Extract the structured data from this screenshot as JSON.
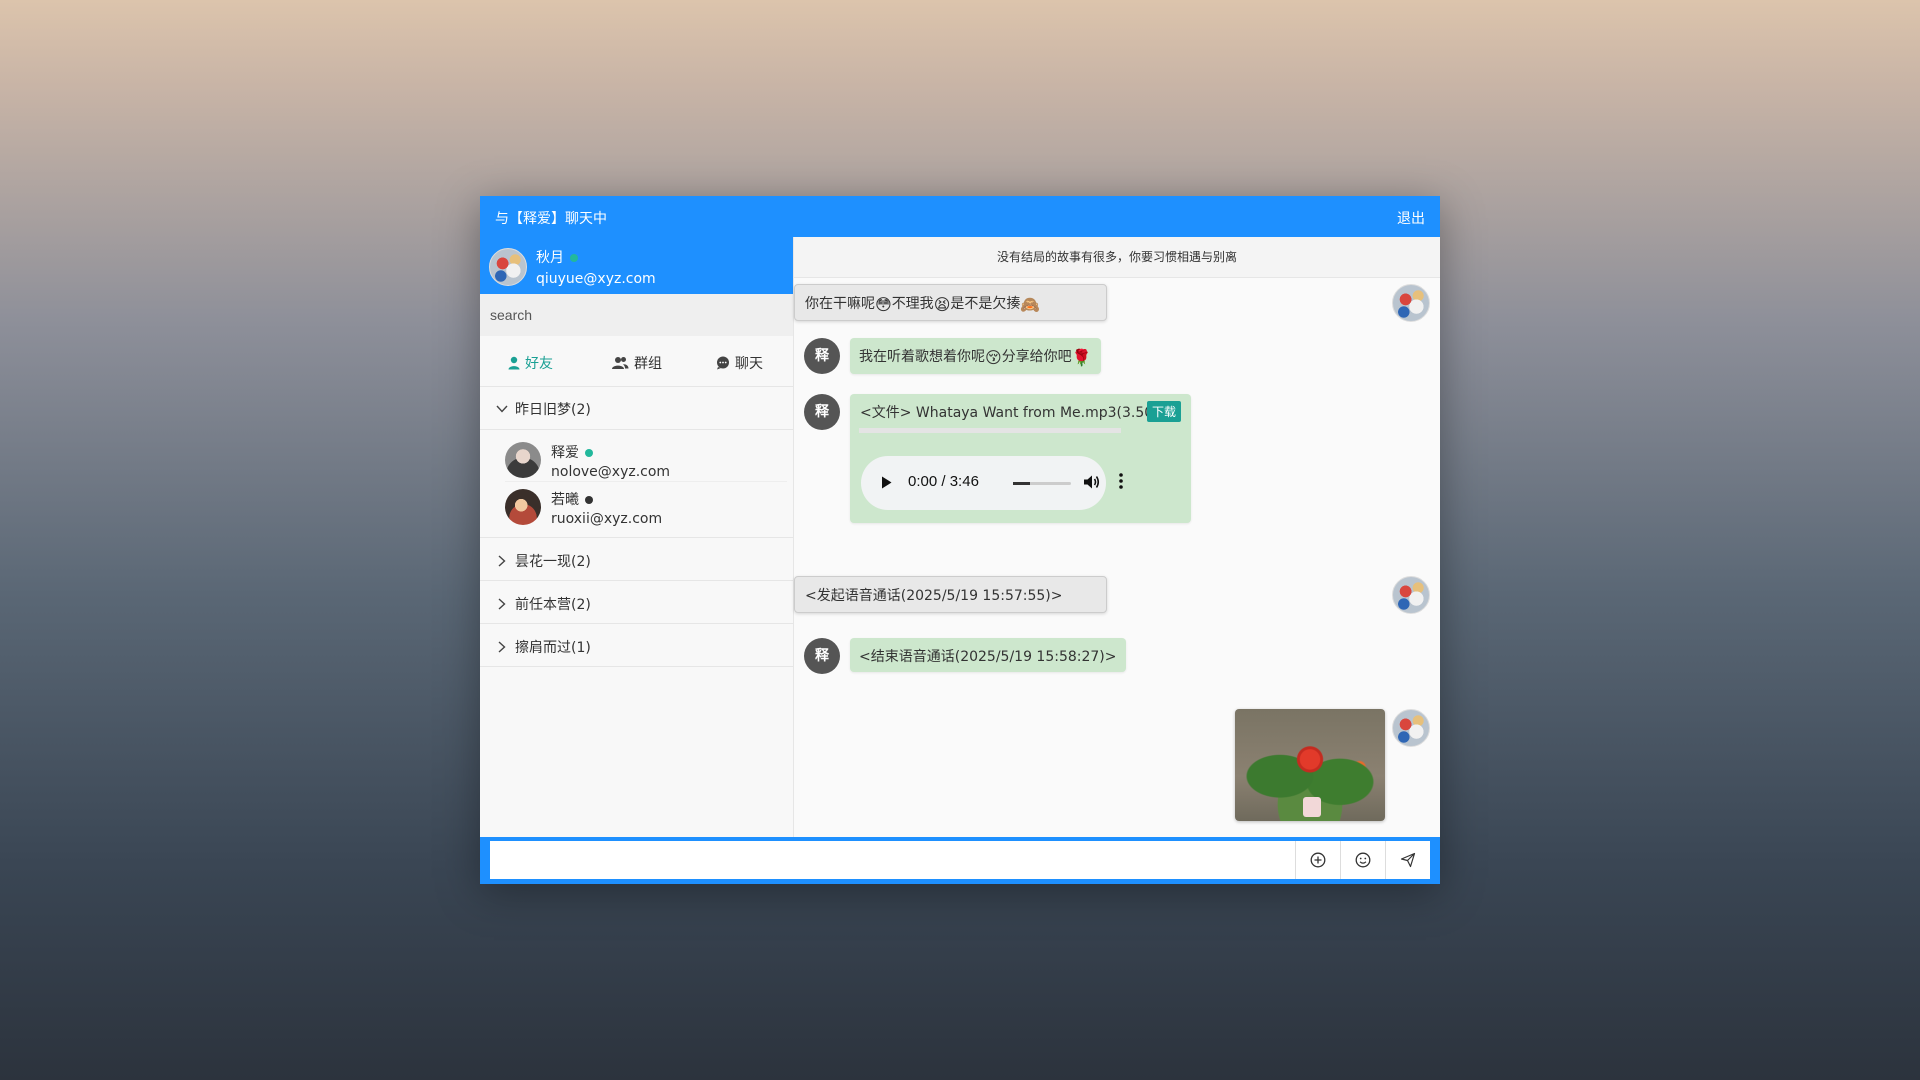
{
  "window": {
    "title": "与【释爱】聊天中",
    "exit_label": "退出"
  },
  "me": {
    "name": "秋月",
    "email": "qiuyue@xyz.com",
    "online": true
  },
  "search": {
    "placeholder": "search"
  },
  "tabs": [
    {
      "label": "好友",
      "icon": "user-icon",
      "active": true
    },
    {
      "label": "群组",
      "icon": "group-icon",
      "active": false
    },
    {
      "label": "聊天",
      "icon": "chat-icon",
      "active": false
    }
  ],
  "groups": [
    {
      "label": "昨日旧梦(2)",
      "expanded": true,
      "friends": [
        {
          "name": "释爱",
          "email": "nolove@xyz.com",
          "status": "online"
        },
        {
          "name": "若曦",
          "email": "ruoxii@xyz.com",
          "status": "offline"
        }
      ]
    },
    {
      "label": "昙花一现(2)",
      "expanded": false
    },
    {
      "label": "前任本营(2)",
      "expanded": false
    },
    {
      "label": "擦肩而过(1)",
      "expanded": false
    }
  ],
  "chat": {
    "signature": "没有结局的故事有很多，你要习惯相遇与别离",
    "other_avatar_char": "释",
    "messages": [
      {
        "from": "me",
        "type": "text",
        "parts": [
          "你在干嘛呢",
          "😳",
          "不理我",
          "😫",
          "是不是欠揍",
          "🙈"
        ]
      },
      {
        "from": "other",
        "type": "text",
        "parts": [
          "我在听着歌想着你呢",
          "😚",
          "分享给你吧",
          "🌹"
        ]
      },
      {
        "from": "other",
        "type": "file",
        "text": "<文件> Whataya Want from Me.mp3(3.50MB)",
        "download_label": "下载",
        "audio": {
          "current": "0:00",
          "duration": "3:46",
          "separator": "/"
        }
      },
      {
        "from": "me",
        "type": "text",
        "text": "<发起语音通话(2025/5/19 15:57:55)>"
      },
      {
        "from": "other",
        "type": "text",
        "text": "<结束语音通话(2025/5/19 15:58:27)>"
      },
      {
        "from": "me",
        "type": "image",
        "image": "flower-photo"
      }
    ]
  },
  "composer": {
    "value": "",
    "buttons": [
      "add-icon",
      "emoji-icon",
      "send-icon"
    ]
  },
  "colors": {
    "primary": "#1e90ff",
    "accent": "#1aa094",
    "bubble_other": "#cde7cd",
    "bubble_me": "#e8e8e8"
  }
}
